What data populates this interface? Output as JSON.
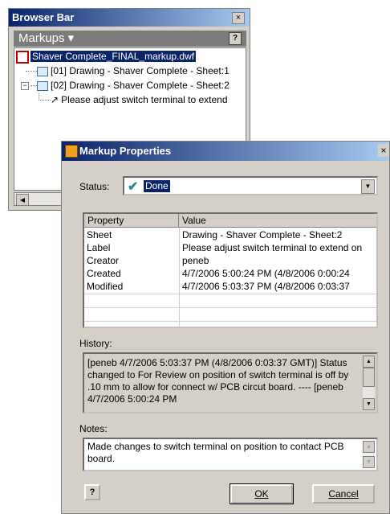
{
  "browser_bar": {
    "title": "Browser Bar",
    "close_glyph": "×",
    "markups_label": "Markups ▾",
    "help_glyph": "?",
    "tree": [
      {
        "label": "Shaver Complete_FINAL_markup.dwf",
        "icon": "dwf-document-icon",
        "selected": true
      },
      {
        "label": "[01] Drawing - Shaver Complete - Sheet:1",
        "icon": "sheet-icon"
      },
      {
        "label": "[02] Drawing - Shaver Complete - Sheet:2",
        "icon": "sheet-icon",
        "expander": "−"
      },
      {
        "label": "Please adjust switch terminal to extend",
        "icon": "markup-arrow-icon"
      }
    ],
    "scroll_left_glyph": "◀"
  },
  "dialog": {
    "title": "Markup Properties",
    "close_glyph": "×",
    "status_label": "Status:",
    "status_value": "Done",
    "status_check_glyph": "✔",
    "dropdown_glyph": "▼",
    "table_headers": [
      "Property",
      "Value"
    ],
    "table_rows": [
      {
        "property": "Sheet",
        "value": "Drawing - Shaver Complete - Sheet:2"
      },
      {
        "property": "Label",
        "value": "Please adjust switch terminal to extend on"
      },
      {
        "property": "Creator",
        "value": "peneb"
      },
      {
        "property": "Created",
        "value": "4/7/2006  5:00:24 PM  (4/8/2006  0:00:24"
      },
      {
        "property": "Modified",
        "value": "4/7/2006  5:03:37 PM  (4/8/2006  0:03:37"
      }
    ],
    "history_label": "History:",
    "history_text": "[peneb  4/7/2006  5:03:37 PM  (4/8/2006  0:03:37 GMT)] Status changed to For Review on position of switch terminal is off by .10 mm to allow for connect w/ PCB circut board. ---- [peneb  4/7/2006  5:00:24 PM",
    "notes_label": "Notes:",
    "notes_text": "Made changes to switch terminal on position to contact PCB board.",
    "help_glyph": "?",
    "ok_label": "OK",
    "cancel_label": "Cancel",
    "scroll_up_glyph": "▲",
    "scroll_down_glyph": "▼"
  }
}
